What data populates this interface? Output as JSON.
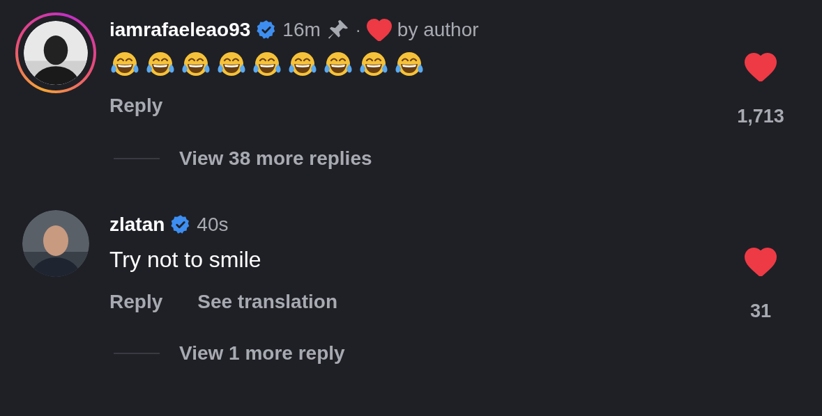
{
  "comments": [
    {
      "username": "iamrafaeleao93",
      "verified": true,
      "time": "16m",
      "pinned": true,
      "separator": "·",
      "liked_by_author": true,
      "liked_by_author_label": "by author",
      "story_ring": true,
      "emojis": [
        {
          "kind": "tears-of-joy"
        },
        {
          "kind": "tears-of-joy"
        },
        {
          "kind": "tears-of-joy"
        },
        {
          "kind": "tears-of-joy"
        },
        {
          "kind": "tears-of-joy"
        },
        {
          "kind": "tears-of-joy"
        },
        {
          "kind": "tears-of-joy"
        },
        {
          "kind": "tears-of-joy"
        },
        {
          "kind": "tears-of-joy"
        }
      ],
      "actions": [
        "Reply"
      ],
      "liked": true,
      "like_count": "1,713",
      "view_replies": "View 38 more replies"
    },
    {
      "username": "zlatan",
      "verified": true,
      "time": "40s",
      "pinned": false,
      "liked_by_author": false,
      "story_ring": false,
      "text": "Try not to smile",
      "actions": [
        "Reply",
        "See translation"
      ],
      "liked": true,
      "like_count": "31",
      "view_replies": "View 1 more reply"
    }
  ]
}
